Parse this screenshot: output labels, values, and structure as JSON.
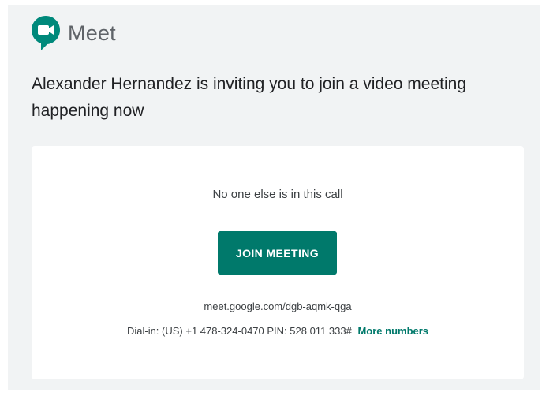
{
  "brand": {
    "name": "Meet",
    "icon": "google-meet-logo-icon",
    "icon_color": "#00897b"
  },
  "invitation": {
    "text": "Alexander Hernandez is inviting you to join a video meeting happening now"
  },
  "card": {
    "status": "No one else is in this call",
    "join_label": "JOIN MEETING",
    "meeting_link": "meet.google.com/dgb-aqmk-qga",
    "dial_in": "Dial-in: (US) +1 478-324-0470 PIN: 528 011 333#",
    "more_numbers_label": "More numbers"
  },
  "colors": {
    "accent": "#00796b",
    "background": "#f1f3f4",
    "card": "#ffffff",
    "text": "#202124"
  }
}
